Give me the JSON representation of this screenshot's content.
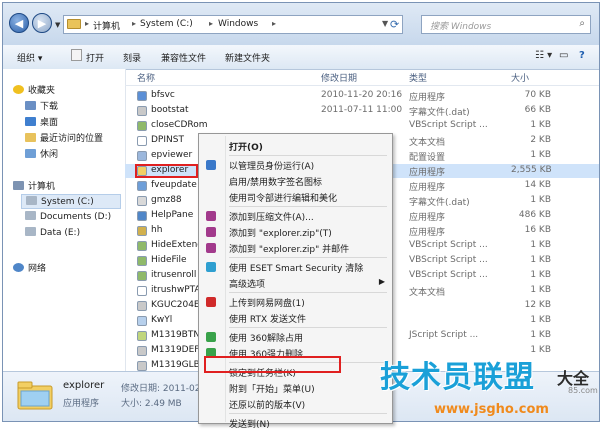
{
  "address": {
    "crumbs": [
      "计算机",
      "System (C:)",
      "Windows"
    ],
    "search_placeholder": "搜索 Windows"
  },
  "toolbar": {
    "organize": "组织 ▾",
    "open": "打开",
    "burn": "刻录",
    "compat": "兼容性文件",
    "new_folder": "新建文件夹"
  },
  "sidebar": {
    "items": [
      {
        "label": "收藏夹",
        "icon": "star-icon"
      },
      {
        "label": "下载",
        "icon": "download-folder-icon"
      },
      {
        "label": "桌面",
        "icon": "desktop-icon"
      },
      {
        "label": "最近访问的位置",
        "icon": "recent-places-icon"
      },
      {
        "label": "休闲",
        "icon": "folder-icon"
      },
      {
        "label": "计算机",
        "icon": "computer-icon"
      },
      {
        "label": "System (C:)",
        "icon": "drive-icon"
      },
      {
        "label": "Documents (D:)",
        "icon": "drive-icon"
      },
      {
        "label": "Data (E:)",
        "icon": "drive-icon"
      },
      {
        "label": "网络",
        "icon": "network-icon"
      }
    ]
  },
  "columns": {
    "name": "名称",
    "date": "修改日期",
    "type": "类型",
    "size": "大小"
  },
  "files": [
    {
      "name": "bfsvc",
      "date": "2010-11-20 20:16",
      "type": "应用程序",
      "size": "70 KB"
    },
    {
      "name": "bootstat",
      "date": "2011-07-11 11:00",
      "type": "字幕文件(.dat)",
      "size": "66 KB"
    },
    {
      "name": "closeCDRom",
      "date": "",
      "type": "VBScript Script ...",
      "size": "1 KB"
    },
    {
      "name": "DPINST",
      "date": "",
      "type": "文本文档",
      "size": "2 KB"
    },
    {
      "name": "epviewer",
      "date": "",
      "type": "配置设置",
      "size": "1 KB"
    },
    {
      "name": "explorer",
      "date": "",
      "type": "应用程序",
      "size": "2,555 KB"
    },
    {
      "name": "fveupdate",
      "date": "",
      "type": "应用程序",
      "size": "14 KB"
    },
    {
      "name": "gmz88",
      "date": "",
      "type": "字幕文件(.dat)",
      "size": "1 KB"
    },
    {
      "name": "HelpPane",
      "date": "",
      "type": "应用程序",
      "size": "486 KB"
    },
    {
      "name": "hh",
      "date": "",
      "type": "应用程序",
      "size": "16 KB"
    },
    {
      "name": "HideExtendN",
      "date": "",
      "type": "VBScript Script ...",
      "size": "1 KB"
    },
    {
      "name": "HideFile",
      "date": "",
      "type": "VBScript Script ...",
      "size": "1 KB"
    },
    {
      "name": "itrusenroll",
      "date": "",
      "type": "VBScript Script ...",
      "size": "1 KB"
    },
    {
      "name": "itrushwPTA",
      "date": "",
      "type": "文本文档",
      "size": "1 KB"
    },
    {
      "name": "KGUC204E.D",
      "date": "",
      "type": "",
      "size": "12 KB"
    },
    {
      "name": "KwYl",
      "date": "",
      "type": "",
      "size": "1 KB"
    },
    {
      "name": "M1319BTN",
      "date": "",
      "type": "JScript Script ...",
      "size": "1 KB"
    },
    {
      "name": "M1319DEF",
      "date": "",
      "type": "",
      "size": "1 KB"
    },
    {
      "name": "M1319GLB",
      "date": "",
      "type": "",
      "size": ""
    }
  ],
  "context_menu": [
    {
      "label": "打开(O)",
      "bold": true,
      "icon": ""
    },
    {
      "label": "以管理员身份运行(A)",
      "icon": "shield-icon"
    },
    {
      "label": "启用/禁用数字签名图标",
      "icon": ""
    },
    {
      "label": "使用司令部进行编辑和美化",
      "icon": ""
    },
    {
      "label": "添加到压缩文件(A)...",
      "icon": "archive-icon"
    },
    {
      "label": "添加到 \"explorer.zip\"(T)",
      "icon": "archive-icon"
    },
    {
      "label": "添加到 \"explorer.zip\" 并邮件",
      "icon": "archive-icon"
    },
    {
      "label": "使用 ESET Smart Security 清除",
      "icon": "eset-icon"
    },
    {
      "label": "高级选项",
      "icon": "",
      "submenu": true
    },
    {
      "label": "上传到网易网盘(1)",
      "icon": "upload-icon"
    },
    {
      "label": "使用 RTX 发送文件",
      "icon": ""
    },
    {
      "label": "使用 360解除占用",
      "icon": "unlock-icon"
    },
    {
      "label": "使用 360强力删除",
      "icon": "delete-icon"
    },
    {
      "label": "锁定到任务栏(K)",
      "icon": ""
    },
    {
      "label": "附到「开始」菜单(U)",
      "icon": ""
    },
    {
      "label": "还原以前的版本(V)",
      "icon": ""
    },
    {
      "label": "发送到(N)",
      "icon": ""
    }
  ],
  "details": {
    "name": "explorer",
    "modified": "修改日期: 2011-02-25 1",
    "type": "应用程序",
    "size": "大小: 2.49 MB"
  },
  "watermark": {
    "main": "技术员联盟",
    "sub": "大全",
    "url": "www.jsgho.com",
    "num": "85.com"
  }
}
